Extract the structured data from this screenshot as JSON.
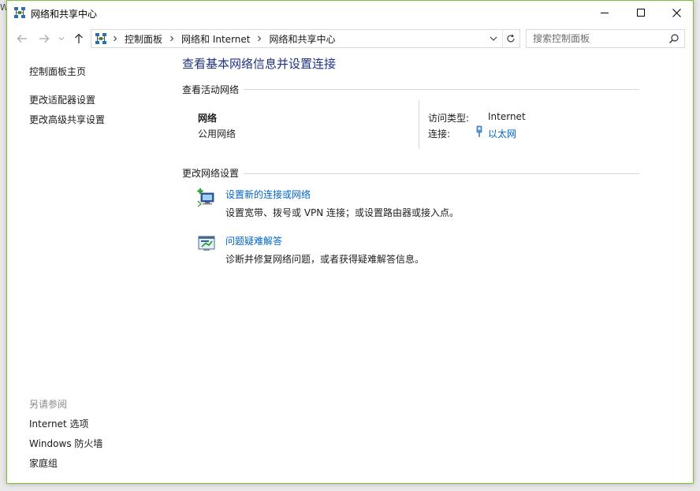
{
  "window": {
    "title": "网络和共享中心",
    "accent_color": "#7fc03a",
    "behind_window_text": "W"
  },
  "titlebar": {
    "app_icon": "network-center-icon",
    "controls": [
      "minimize-icon",
      "maximize-icon",
      "close-icon"
    ]
  },
  "addressbar": {
    "nav": [
      "back-arrow-icon",
      "forward-arrow-icon",
      "recent-dropdown-icon",
      "up-arrow-icon"
    ],
    "breadcrumbs": [
      "控制面板",
      "网络和 Internet",
      "网络和共享中心"
    ],
    "search_placeholder": "搜索控制面板"
  },
  "sidebar": {
    "home": "控制面板主页",
    "adapter_settings": "更改适配器设置",
    "advanced_sharing": "更改高级共享设置",
    "see_also_title": "另请参阅",
    "see_also": [
      "Internet 选项",
      "Windows 防火墙",
      "家庭组"
    ]
  },
  "main": {
    "heading": "查看基本网络信息并设置连接",
    "active_networks_title": "查看活动网络",
    "network": {
      "name": "网络",
      "profile": "公用网络",
      "access_type_label": "访问类型:",
      "access_type_value": "Internet",
      "connection_label": "连接:",
      "connection_value": "以太网"
    },
    "change_settings_title": "更改网络设置",
    "tasks": [
      {
        "icon": "new-connection-icon",
        "link": "设置新的连接或网络",
        "desc": "设置宽带、拨号或 VPN 连接；或设置路由器或接入点。"
      },
      {
        "icon": "troubleshoot-icon",
        "link": "问题疑难解答",
        "desc": "诊断并修复网络问题，或者获得疑难解答信息。"
      }
    ]
  },
  "colors": {
    "link": "#0066cc",
    "heading": "#1e3287",
    "muted": "#8a8a8a"
  }
}
